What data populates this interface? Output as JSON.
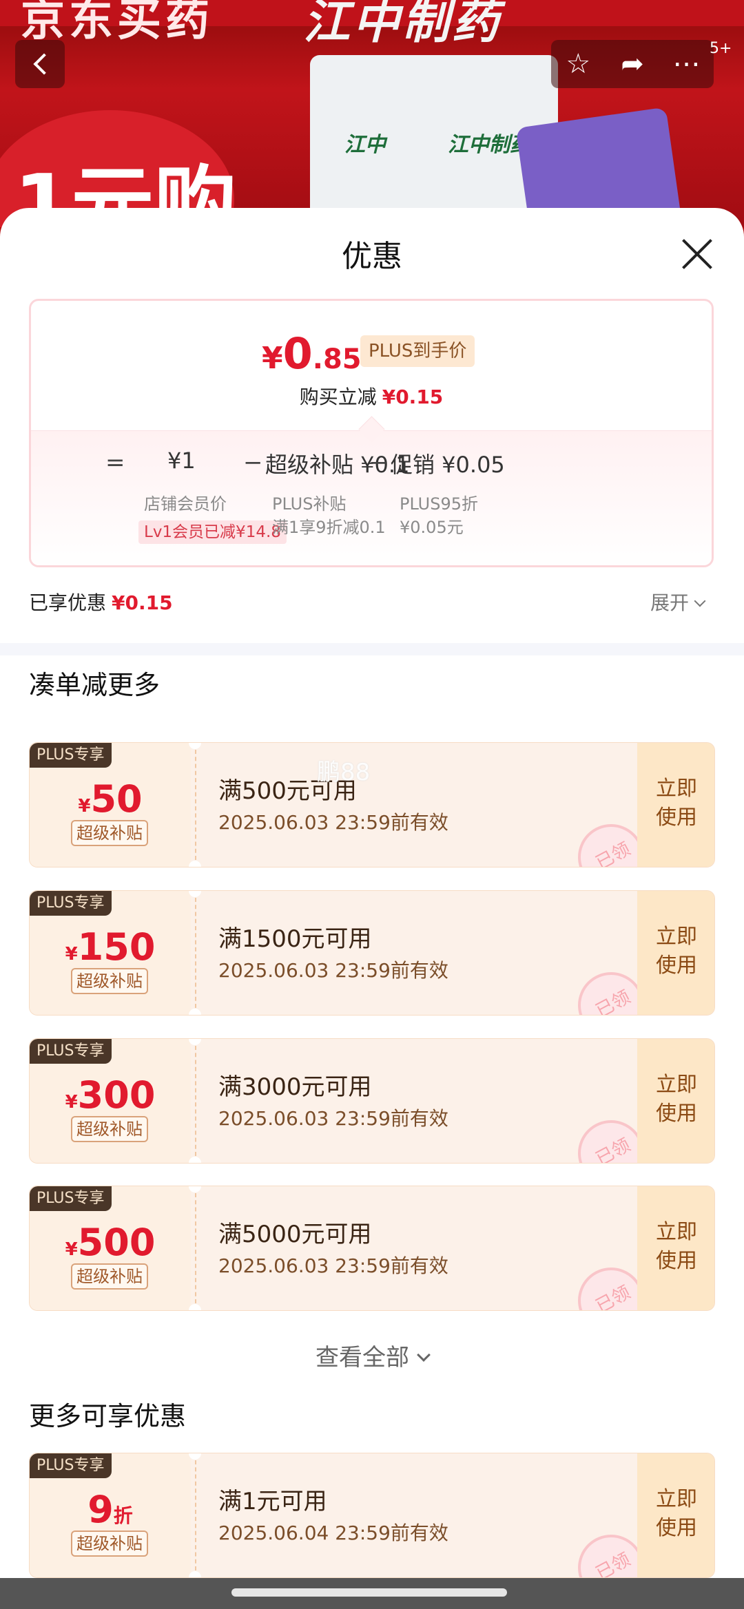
{
  "background": {
    "brand_text": "京东买药",
    "brand_text2": "江中制药",
    "pack_text1": "江中",
    "pack_text2": "江中制药",
    "promo_text": "1元购",
    "notification_count": "5+"
  },
  "sheet": {
    "title": "优惠",
    "price": {
      "yen": "¥",
      "integer": "0",
      "decimal": ".85",
      "tag": "PLUS到手价"
    },
    "instant": {
      "label": "购买立减",
      "value": "¥0.15"
    },
    "breakdown": {
      "equals": "=",
      "minus": "−",
      "member_price": {
        "value": "¥1",
        "label": "店铺会员价",
        "tag": "Lv1会员已减¥14.8"
      },
      "super_subsidy": {
        "value": "超级补贴 ¥0.1",
        "label": "PLUS补贴",
        "label2": "满1享9折减0.1"
      },
      "promotion": {
        "value": "促销 ¥0.05",
        "label": "PLUS95折",
        "label2": "¥0.05元"
      }
    },
    "enjoyed": {
      "label": "已享优惠",
      "value": "¥0.15"
    },
    "expand_label": "展开"
  },
  "section1_title": "凑单减更多",
  "watermark": "鹏88",
  "coupons": [
    {
      "plus": "PLUS专享",
      "yen": "¥",
      "amount": "50",
      "subsidy": "超级补贴",
      "condition": "满500元可用",
      "valid": "2025.06.03 23:59前有效",
      "use": "立即使用",
      "stamp": "已领"
    },
    {
      "plus": "PLUS专享",
      "yen": "¥",
      "amount": "150",
      "subsidy": "超级补贴",
      "condition": "满1500元可用",
      "valid": "2025.06.03 23:59前有效",
      "use": "立即使用",
      "stamp": "已领"
    },
    {
      "plus": "PLUS专享",
      "yen": "¥",
      "amount": "300",
      "subsidy": "超级补贴",
      "condition": "满3000元可用",
      "valid": "2025.06.03 23:59前有效",
      "use": "立即使用",
      "stamp": "已领"
    },
    {
      "plus": "PLUS专享",
      "yen": "¥",
      "amount": "500",
      "subsidy": "超级补贴",
      "condition": "满5000元可用",
      "valid": "2025.06.03 23:59前有效",
      "use": "立即使用",
      "stamp": "已领"
    }
  ],
  "view_all": "查看全部",
  "section2_title": "更多可享优惠",
  "more_coupon": {
    "plus": "PLUS专享",
    "amount": "9",
    "unit": "折",
    "subsidy": "超级补贴",
    "condition": "满1元可用",
    "valid": "2025.06.04 23:59前有效",
    "use": "立即使用",
    "stamp": "已领"
  },
  "colors": {
    "accent_red": "#e11a2e",
    "coupon_bg": "#fcf1e9",
    "use_bg": "#fde7c7"
  }
}
